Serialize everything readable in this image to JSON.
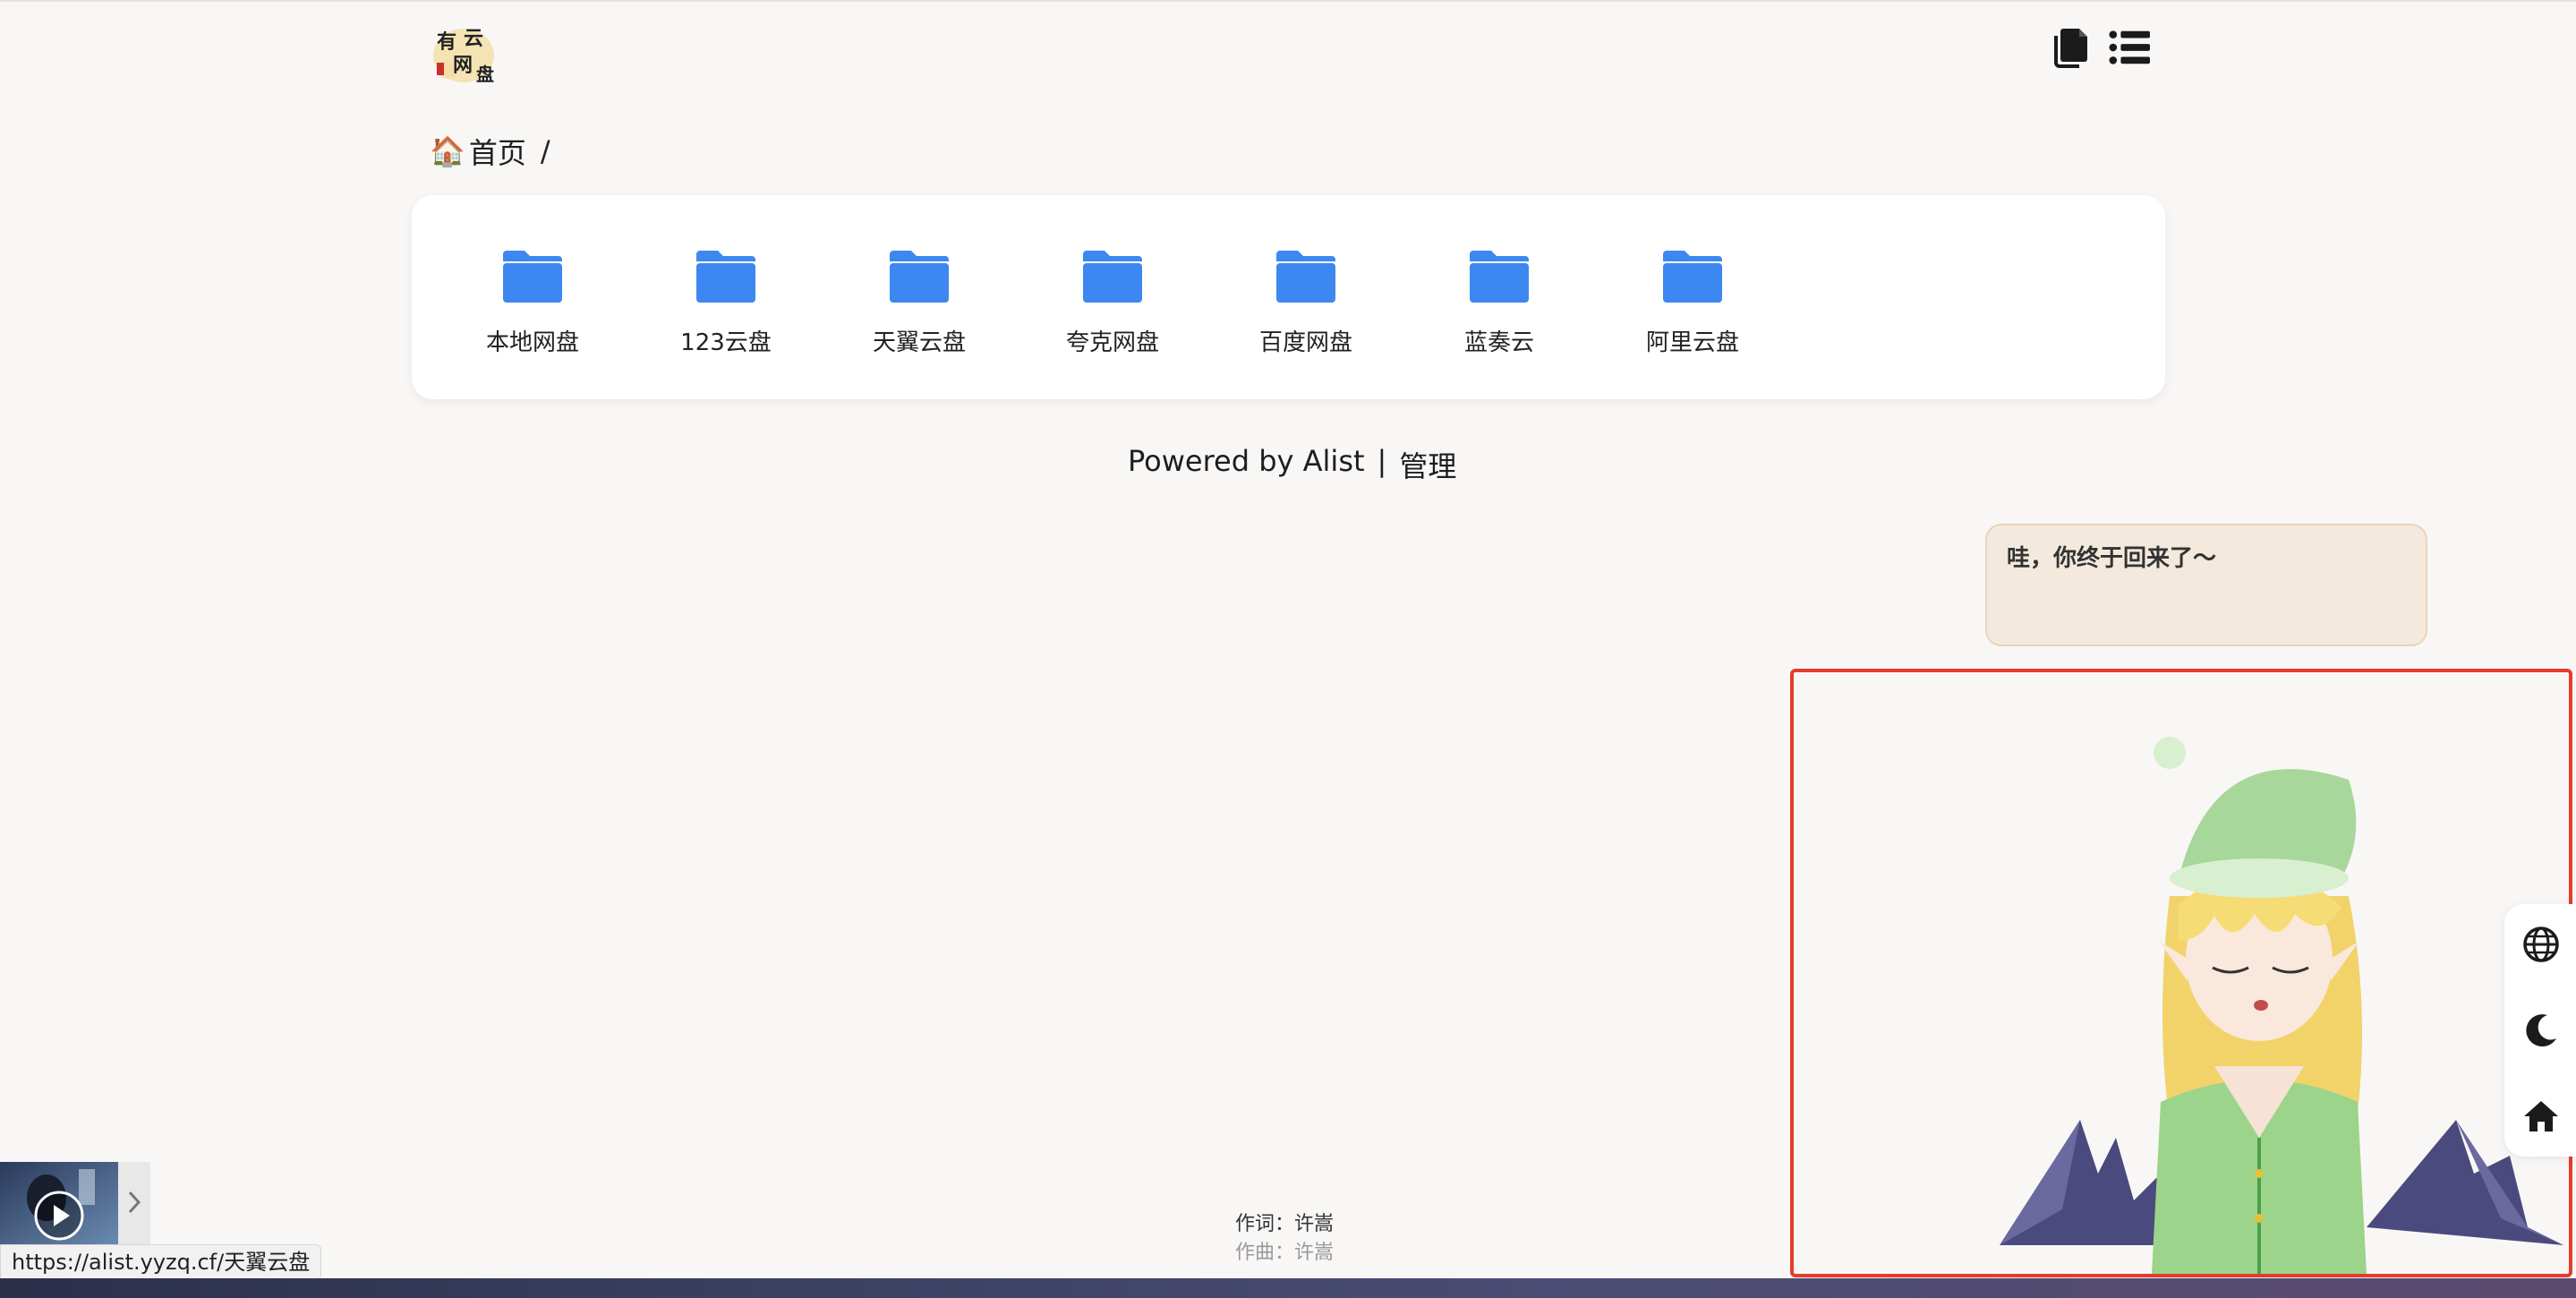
{
  "header": {
    "logo_text": "有云网盘",
    "buttons": [
      {
        "icon": "copy-icon"
      },
      {
        "icon": "list-view-icon"
      }
    ]
  },
  "breadcrumb": {
    "home_emoji": "🏠",
    "home_label": "首页",
    "separator": "/"
  },
  "folders": [
    {
      "name": "本地网盘"
    },
    {
      "name": "123云盘"
    },
    {
      "name": "天翼云盘"
    },
    {
      "name": "夸克网盘"
    },
    {
      "name": "百度网盘"
    },
    {
      "name": "蓝奏云"
    },
    {
      "name": "阿里云盘"
    }
  ],
  "footer": {
    "powered_text": "Powered by Alist",
    "divider": "|",
    "admin_link": "管理"
  },
  "mascot": {
    "speech": "哇，你终于回来了～"
  },
  "side_toolbar": [
    {
      "icon": "globe-icon"
    },
    {
      "icon": "moon-icon"
    },
    {
      "icon": "home-icon"
    }
  ],
  "lyrics": {
    "line1": "作词：许嵩",
    "line2": "作曲：许嵩"
  },
  "status_bar": {
    "url": "https://alist.yyzq.cf/天翼云盘"
  },
  "colors": {
    "folder": "#3d88f0",
    "background": "#f9f7f5",
    "mascot_border": "#e53b2e",
    "bubble_bg": "#f3e9dd"
  }
}
